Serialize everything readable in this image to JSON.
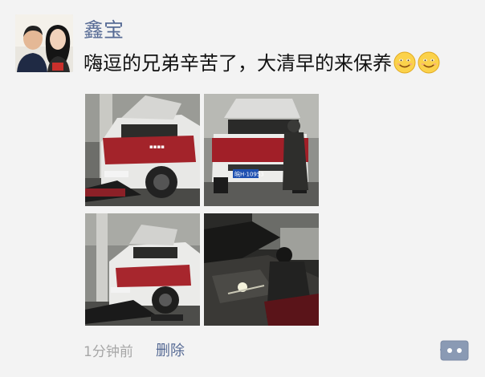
{
  "post": {
    "username": "鑫宝",
    "text": "嗨逗的兄弟辛苦了，大清早的来保养",
    "emojis": [
      "smile-emoji",
      "smile-emoji"
    ],
    "photos": [
      {
        "plate_text": ""
      },
      {
        "plate_text": "皖H·10953"
      },
      {
        "plate_text": ""
      },
      {
        "plate_text": ""
      }
    ],
    "timestamp": "1分钟前",
    "delete_label": "删除"
  },
  "colors": {
    "background": "#f3f3f3",
    "username": "#576b95",
    "link": "#576b95",
    "timestamp": "#a6a6a6",
    "text": "#111111",
    "comment_button": "#8a9ab4"
  },
  "icons": {
    "comment": "comment-dots-icon"
  }
}
